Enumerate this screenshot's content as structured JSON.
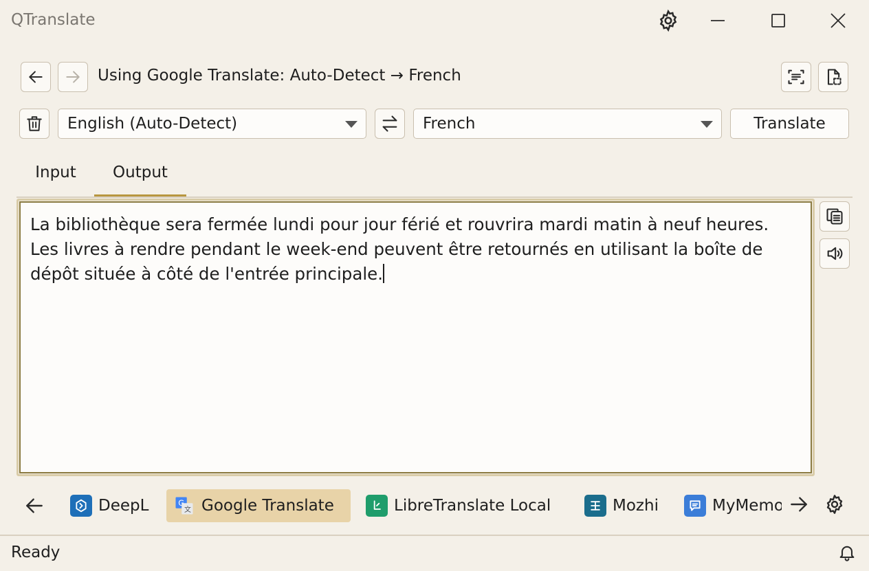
{
  "window": {
    "title": "QTranslate",
    "settings_icon": "gear-icon",
    "minimize_icon": "minimize-icon",
    "maximize_icon": "maximize-icon",
    "close_icon": "close-icon"
  },
  "toolbar": {
    "back_icon": "arrow-left-icon",
    "forward_icon": "arrow-right-icon",
    "status_text": "Using Google Translate: Auto-Detect → French",
    "ocr_icon": "scan-text-icon",
    "screen_capture_icon": "file-select-icon"
  },
  "language_bar": {
    "clear_icon": "trash-icon",
    "source_language": "English (Auto-Detect)",
    "swap_icon": "swap-icon",
    "target_language": "French",
    "translate_label": "Translate"
  },
  "tabs": [
    {
      "label": "Input",
      "active": false
    },
    {
      "label": "Output",
      "active": true
    }
  ],
  "output": {
    "text": "La bibliothèque sera fermée lundi pour jour férié et rouvrira mardi matin à neuf heures. Les livres à rendre pendant le week-end peuvent être retournés en utilisant la boîte de dépôt située à côté de l'entrée principale."
  },
  "side_actions": {
    "copy_icon": "copy-icon",
    "speak_icon": "speaker-icon"
  },
  "services": {
    "prev_icon": "arrow-left-icon",
    "next_icon": "arrow-right-icon",
    "settings_icon": "gear-icon",
    "items": [
      {
        "label": "DeepL",
        "icon": "deepl-icon",
        "color": "#1e6fb8",
        "active": false
      },
      {
        "label": "Google Translate",
        "icon": "google-translate-icon",
        "color": "#4285f4",
        "active": true
      },
      {
        "label": "LibreTranslate Local",
        "icon": "libretranslate-icon",
        "color": "#1f9d6b",
        "active": false
      },
      {
        "label": "Mozhi",
        "icon": "mozhi-icon",
        "color": "#1b6d8c",
        "active": false
      },
      {
        "label": "MyMemory",
        "icon": "mymemory-icon",
        "color": "#3b7dd8",
        "active": false
      }
    ]
  },
  "statusbar": {
    "text": "Ready",
    "notification_icon": "bell-icon"
  },
  "colors": {
    "background": "#f4f0e8",
    "accent": "#b8963f",
    "active_service": "#e8d3a8"
  }
}
